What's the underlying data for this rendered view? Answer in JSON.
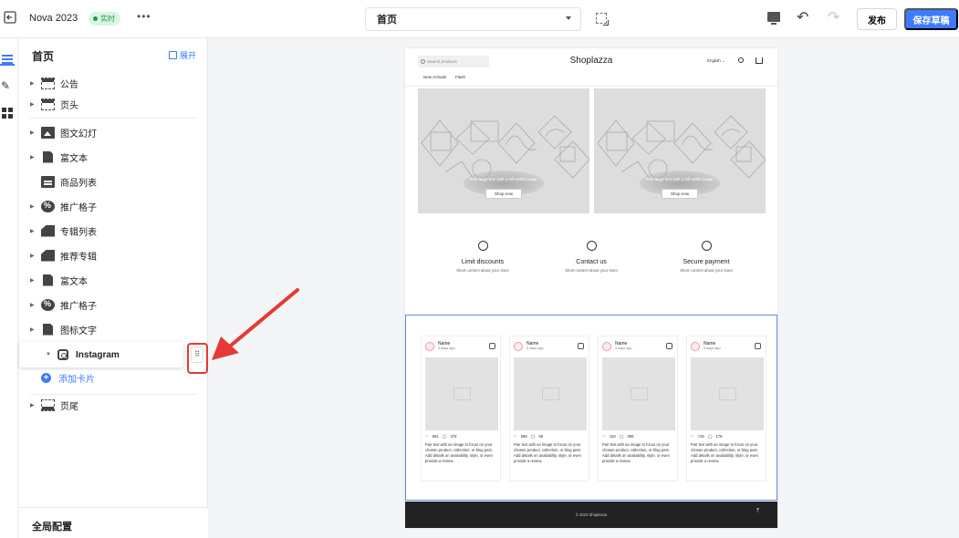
{
  "topbar": {
    "store_name": "Nova 2023",
    "live_badge": "实时",
    "more": "•••",
    "page_select": "首页",
    "publish": "发布",
    "save_draft": "保存草稿"
  },
  "panel": {
    "title": "首页",
    "expand": "展开",
    "items": [
      {
        "label": "公告",
        "icon": "announcement-bar-icon"
      },
      {
        "label": "页头",
        "icon": "header-icon"
      },
      {
        "label": "图文幻灯",
        "icon": "slideshow-icon"
      },
      {
        "label": "富文本",
        "icon": "rich-text-icon"
      },
      {
        "label": "商品列表",
        "icon": "product-list-icon"
      },
      {
        "label": "推广格子",
        "icon": "promo-grid-icon"
      },
      {
        "label": "专辑列表",
        "icon": "collection-list-icon"
      },
      {
        "label": "推荐专辑",
        "icon": "featured-collection-icon"
      },
      {
        "label": "富文本",
        "icon": "rich-text-icon"
      },
      {
        "label": "推广格子",
        "icon": "promo-grid-icon"
      },
      {
        "label": "图标文字",
        "icon": "icon-text-icon"
      },
      {
        "label": "Instagram",
        "icon": "instagram-icon"
      },
      {
        "label": "页尾",
        "icon": "footer-icon"
      }
    ],
    "add_card": "添加卡片",
    "global_settings": "全局配置"
  },
  "preview": {
    "search_placeholder": "Search products",
    "logo": "Shoplazza",
    "language": "English",
    "nav": [
      "New Arrivals",
      "Flash"
    ],
    "banners": [
      {
        "caption": "Pair large text with a full-width image",
        "button": "Shop now"
      },
      {
        "caption": "Pair large text with a full-width image",
        "button": "Shop now"
      }
    ],
    "features": [
      {
        "title": "Limit discounts",
        "subtitle": "Short content about your store"
      },
      {
        "title": "Contact us",
        "subtitle": "Short content about your store"
      },
      {
        "title": "Secure payment",
        "subtitle": "Short content about your store"
      }
    ],
    "posts": [
      {
        "name": "Name",
        "date": "3 days ago",
        "likes": "891",
        "comments": "378",
        "text": "Pair text with an image to focus on your chosen product, collection, or blog post. Add details on availability, style, or even provide a review."
      },
      {
        "name": "Name",
        "date": "3 days ago",
        "likes": "688",
        "comments": "56",
        "text": "Pair text with an image to focus on your chosen product, collection, or blog post. Add details on availability, style, or even provide a review."
      },
      {
        "name": "Name",
        "date": "3 days ago",
        "likes": "163",
        "comments": "899",
        "text": "Pair text with an image to focus on your chosen product, collection, or blog post. Add details on availability, style, or even provide a review."
      },
      {
        "name": "Name",
        "date": "3 days ago",
        "likes": "725",
        "comments": "178",
        "text": "Pair text with an image to focus on your chosen product, collection, or blog post. Add details on availability, style, or even provide a review."
      }
    ],
    "footer": "© 2023 Shoplazza"
  },
  "colors": {
    "accent": "#3d7bff",
    "live_badge_bg": "#d9f5e3",
    "highlight_red": "#e53935",
    "selection_outline": "#6b86e8",
    "footer_bg": "#222222"
  }
}
